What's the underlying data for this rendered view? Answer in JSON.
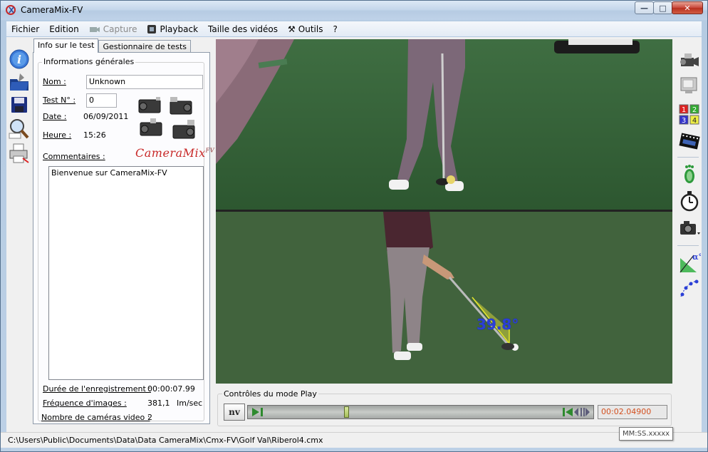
{
  "window": {
    "title": "CameraMix-FV",
    "controls": {
      "minimize": "—",
      "maximize": "□",
      "close": "✕"
    }
  },
  "menu": [
    {
      "label": "Fichier"
    },
    {
      "label": "Edition"
    },
    {
      "label": "Capture",
      "icon": "camera-icon",
      "disabled": true
    },
    {
      "label": "Playback",
      "icon": "film-icon"
    },
    {
      "label": "Taille des vidéos"
    },
    {
      "label": "Outils",
      "icon": "tools-icon"
    },
    {
      "label": "?"
    }
  ],
  "tabs": [
    "Info sur le test",
    "Gestionnaire de tests"
  ],
  "info": {
    "group_title": "Informations générales",
    "name_label": "Nom :",
    "name_value": "Unknown",
    "test_label": "Test N° :",
    "test_value": "0",
    "date_label": "Date :",
    "date_value": "06/09/2011",
    "time_label": "Heure :",
    "time_value": "15:26",
    "comments_label": "Commentaires :",
    "comments_value": "Bienvenue sur  CameraMix-FV",
    "brand": "CameraMix",
    "brand_sup": "FV",
    "duration_label": "Durée de l'enregistrement :",
    "duration_value": "00:00:07.99",
    "fps_label": "Fréquence d'images :",
    "fps_value": "381,1",
    "fps_unit": "Im/sec",
    "cams_label": "Nombre de caméras video :",
    "cams_value": "2"
  },
  "video": {
    "angle": "39.8°"
  },
  "play": {
    "group_title": "Contrôles du mode Play",
    "nv_label": "nv",
    "position": 0.27,
    "time": "00:02.04900",
    "tooltip": "MM:SS.xxxxx"
  },
  "status": {
    "path": "C:\\Users\\Public\\Documents\\Data\\Data CameraMix\\Cmx-FV\\Golf Val\\Riberol4.cmx"
  },
  "right_tools": {
    "grid_numbers": [
      "1",
      "2",
      "3",
      "4"
    ],
    "angle_label": "α°"
  },
  "colors": {
    "brand_red": "#c82828",
    "angle_blue": "#2b3fd6",
    "time_orange": "#d4501f"
  }
}
